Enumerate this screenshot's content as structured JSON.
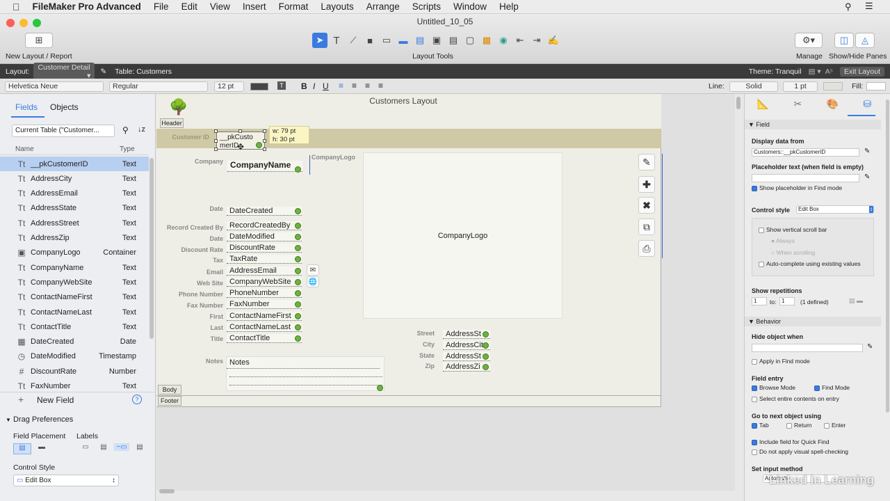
{
  "menubar": {
    "app": "FileMaker Pro Advanced",
    "items": [
      "File",
      "Edit",
      "View",
      "Insert",
      "Format",
      "Layouts",
      "Arrange",
      "Scripts",
      "Window",
      "Help"
    ]
  },
  "window": {
    "title": "Untitled_10_05",
    "new_layout": "New Layout / Report",
    "layout_tools": "Layout Tools",
    "manage": "Manage",
    "show_hide": "Show/Hide Panes"
  },
  "layoutbar": {
    "layout_label": "Layout:",
    "layout_value": "Customer Detail",
    "table": "Table: Customers",
    "theme": "Theme: Tranquil",
    "exit": "Exit Layout"
  },
  "formatbar": {
    "font": "Helvetica Neue",
    "style": "Regular",
    "size": "12 pt",
    "line_label": "Line:",
    "line_style": "Solid",
    "line_width": "1 pt",
    "fill_label": "Fill:"
  },
  "leftpane": {
    "tabs": [
      "Fields",
      "Objects"
    ],
    "table_select": "Current Table (\"Customer...",
    "col_name": "Name",
    "col_type": "Type",
    "fields": [
      {
        "name": "__pkCustomerID",
        "type": "Text",
        "icon": "Tt"
      },
      {
        "name": "AddressCity",
        "type": "Text",
        "icon": "Tt"
      },
      {
        "name": "AddressEmail",
        "type": "Text",
        "icon": "Tt"
      },
      {
        "name": "AddressState",
        "type": "Text",
        "icon": "Tt"
      },
      {
        "name": "AddressStreet",
        "type": "Text",
        "icon": "Tt"
      },
      {
        "name": "AddressZip",
        "type": "Text",
        "icon": "Tt"
      },
      {
        "name": "CompanyLogo",
        "type": "Container",
        "icon": "▣"
      },
      {
        "name": "CompanyName",
        "type": "Text",
        "icon": "Tt"
      },
      {
        "name": "CompanyWebSite",
        "type": "Text",
        "icon": "Tt"
      },
      {
        "name": "ContactNameFirst",
        "type": "Text",
        "icon": "Tt"
      },
      {
        "name": "ContactNameLast",
        "type": "Text",
        "icon": "Tt"
      },
      {
        "name": "ContactTitle",
        "type": "Text",
        "icon": "Tt"
      },
      {
        "name": "DateCreated",
        "type": "Date",
        "icon": "▦"
      },
      {
        "name": "DateModified",
        "type": "Timestamp",
        "icon": "◷"
      },
      {
        "name": "DiscountRate",
        "type": "Number",
        "icon": "#"
      },
      {
        "name": "FaxNumber",
        "type": "Text",
        "icon": "Tt"
      }
    ],
    "new_field": "New Field",
    "drag_prefs": "Drag Preferences",
    "field_placement": "Field Placement",
    "labels": "Labels",
    "control_style": "Control Style",
    "control_style_value": "Edit Box"
  },
  "canvas": {
    "layout_title": "Customers Layout",
    "parts": [
      "Header",
      "Body",
      "Footer"
    ],
    "size_tooltip_w": "w: 79 pt",
    "size_tooltip_h": "h: 30 pt",
    "selected_field": "__pkCustomerID",
    "labels": {
      "customer_id": "Customer ID",
      "company": "Company",
      "date": "Date",
      "record_created_by": "Record Created By",
      "date2": "Date",
      "discount_rate": "Discount Rate",
      "tax": "Tax",
      "email": "Email",
      "web_site": "Web Site",
      "phone": "Phone Number",
      "fax": "Fax Number",
      "first": "First",
      "last": "Last",
      "title": "Title",
      "notes": "Notes",
      "street": "Street",
      "city": "City",
      "state": "State",
      "zip": "Zip",
      "company_logo": "CompanyLogo"
    },
    "fields": {
      "pk": "__pkCusto merID",
      "company_name": "CompanyName",
      "date_created": "DateCreated",
      "record_created_by": "RecordCreatedBy",
      "date_modified": "DateModified",
      "discount_rate": "DiscountRate",
      "tax_rate": "TaxRate",
      "address_email": "AddressEmail",
      "company_web": "CompanyWebSite",
      "phone": "PhoneNumber",
      "fax": "FaxNumber",
      "first": "ContactNameFirst",
      "last": "ContactNameLast",
      "title": "ContactTitle",
      "notes": "Notes",
      "street": "AddressSt",
      "city": "AddressCit",
      "state": "AddressSt",
      "zip": "AddressZi",
      "logo": "CompanyLogo"
    }
  },
  "inspector": {
    "field_section": "Field",
    "display_data_from": "Display data from",
    "display_value": "Customers::__pkCustomerID",
    "placeholder_label": "Placeholder text (when field is empty)",
    "show_placeholder": "Show placeholder in Find mode",
    "control_style": "Control style",
    "control_style_value": "Edit Box",
    "show_scroll": "Show vertical scroll bar",
    "always": "Always",
    "when_scrolling": "When scrolling",
    "autocomplete": "Auto-complete using existing values",
    "show_repetitions": "Show repetitions",
    "rep_from": "1",
    "rep_to_label": "to:",
    "rep_to": "1",
    "rep_defined": "(1 defined)",
    "behavior_section": "Behavior",
    "hide_object_when": "Hide object when",
    "apply_find": "Apply in Find mode",
    "field_entry": "Field entry",
    "browse_mode": "Browse Mode",
    "find_mode": "Find Mode",
    "select_entire": "Select entire contents on entry",
    "go_next": "Go to next object using",
    "tab": "Tab",
    "return": "Return",
    "enter": "Enter",
    "quick_find": "Include field for Quick Find",
    "spell": "Do not apply visual spell-checking",
    "input_method": "Set input method",
    "input_value": "Automatic"
  },
  "watermark": "Linked in Learning",
  "colors": {
    "accent": "#3a7be0",
    "selected_row": "#b7cff0",
    "layoutbar": "#3b3b3b"
  }
}
